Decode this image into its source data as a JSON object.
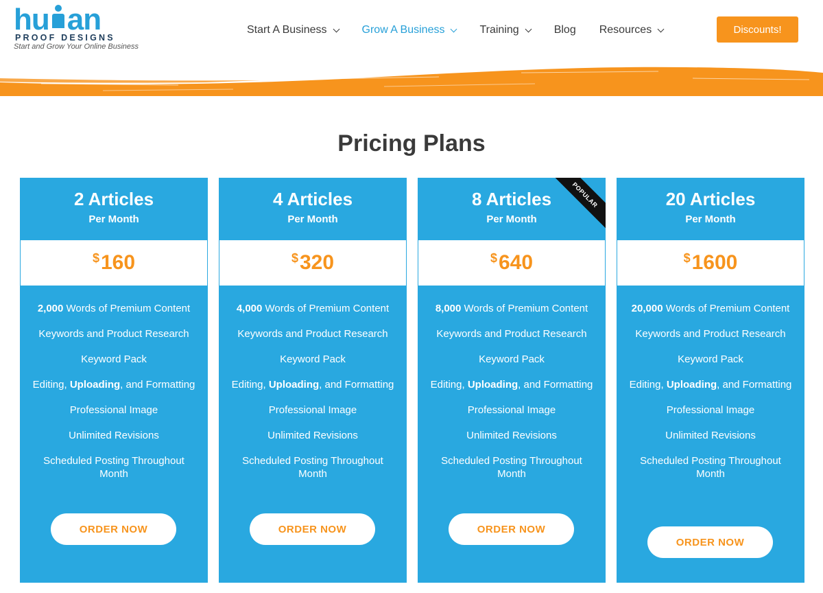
{
  "logo": {
    "word_left": "hu",
    "word_right": "an",
    "sub": "PROOF DESIGNS",
    "tagline": "Start and Grow Your Online Business"
  },
  "nav": {
    "items": [
      {
        "label": "Start A Business",
        "has_dropdown": true
      },
      {
        "label": "Grow A Business",
        "has_dropdown": true
      },
      {
        "label": "Training",
        "has_dropdown": true
      },
      {
        "label": "Blog",
        "has_dropdown": false
      },
      {
        "label": "Resources",
        "has_dropdown": true
      }
    ],
    "discount_label": "Discounts!"
  },
  "colors": {
    "accent_blue": "#29a8e0",
    "accent_orange": "#f7941d"
  },
  "page_title": "Pricing Plans",
  "plans": [
    {
      "title": "2 Articles",
      "period": "Per Month",
      "currency": "$",
      "price": "160",
      "words_bold": "2,000",
      "words_rest": " Words of Premium Content",
      "features": [
        "Keywords and Product Research",
        "Keyword Pack"
      ],
      "editing_pre": "Editing, ",
      "editing_bold": "Uploading",
      "editing_post": ", and Formatting",
      "features2": [
        "Professional Image",
        "Unlimited Revisions",
        "Scheduled Posting Throughout Month"
      ],
      "button": "ORDER NOW"
    },
    {
      "title": "4 Articles",
      "period": "Per Month",
      "currency": "$",
      "price": "320",
      "words_bold": "4,000",
      "words_rest": " Words of Premium Content",
      "features": [
        "Keywords and Product Research",
        "Keyword Pack"
      ],
      "editing_pre": "Editing, ",
      "editing_bold": "Uploading",
      "editing_post": ", and Formatting",
      "features2": [
        "Professional Image",
        "Unlimited Revisions",
        "Scheduled Posting Throughout Month"
      ],
      "button": "ORDER NOW"
    },
    {
      "title": "8 Articles",
      "period": "Per Month",
      "currency": "$",
      "price": "640",
      "ribbon": "POPULAR",
      "words_bold": "8,000",
      "words_rest": " Words of Premium Content",
      "features": [
        "Keywords and Product Research",
        "Keyword Pack"
      ],
      "editing_pre": "Editing, ",
      "editing_bold": "Uploading",
      "editing_post": ", and Formatting",
      "features2": [
        "Professional Image",
        "Unlimited Revisions",
        "Scheduled Posting Throughout Month"
      ],
      "button": "ORDER NOW"
    },
    {
      "title": "20 Articles",
      "period": "Per Month",
      "currency": "$",
      "price": "1600",
      "words_bold": "20,000",
      "words_rest": " Words of Premium Content",
      "features": [
        "Keywords and Product Research",
        "Keyword Pack"
      ],
      "editing_pre": "Editing, ",
      "editing_bold": "Uploading",
      "editing_post": ", and Formatting",
      "features2": [
        "Professional Image",
        "Unlimited Revisions",
        "Scheduled Posting Throughout Month"
      ],
      "button": "ORDER NOW"
    }
  ]
}
